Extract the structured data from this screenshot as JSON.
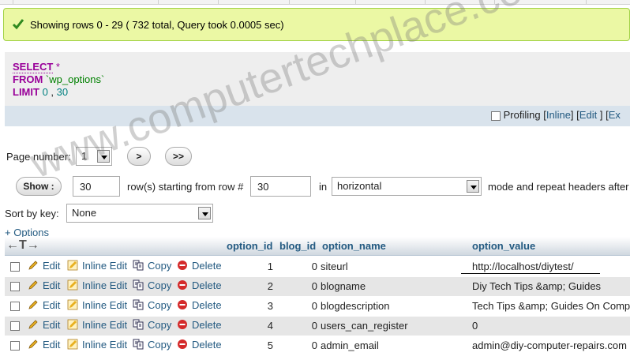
{
  "status": {
    "message": "Showing rows 0 - 29 ( 732 total, Query took 0.0005 sec)"
  },
  "sql": {
    "select_kw": "SELECT",
    "star": "*",
    "from_kw": "FROM",
    "table": "`wp_options`",
    "limit_kw": "LIMIT",
    "limit_start": "0",
    "limit_sep": ",",
    "limit_count": "30"
  },
  "options_bar": {
    "profiling_label": "Profiling",
    "open_bracket_1": "[",
    "inline_label": "Inline",
    "close_bracket_1": "]",
    "open_bracket_2": "[",
    "edit_label": "Edit",
    "close_bracket_3": "]",
    "open_bracket_3": "[",
    "explain_label": "Ex"
  },
  "navigation": {
    "page_number_label": "Page number:",
    "page_number_value": "1",
    "next_label": ">",
    "last_label": ">>",
    "show_label": "Show :",
    "rows_value": "30",
    "rows_label": "row(s) starting from row #",
    "start_row_value": "30",
    "in_label": "in",
    "mode_value": "horizontal",
    "mode_label": "mode and repeat headers after",
    "sort_label": "Sort by key:",
    "sort_value": "None",
    "options_link": "+ Options"
  },
  "table": {
    "columns": [
      "option_id",
      "blog_id",
      "option_name",
      "option_value"
    ],
    "actions": {
      "edit": "Edit",
      "inline_edit": "Inline Edit",
      "copy": "Copy",
      "delete": "Delete"
    },
    "rows": [
      {
        "option_id": "1",
        "blog_id": "0",
        "option_name": "siteurl",
        "option_value": "http://localhost/diytest/"
      },
      {
        "option_id": "2",
        "blog_id": "0",
        "option_name": "blogname",
        "option_value": "Diy Tech Tips &amp; Guides"
      },
      {
        "option_id": "3",
        "blog_id": "0",
        "option_name": "blogdescription",
        "option_value": "Tech Tips &amp; Guides On Comp"
      },
      {
        "option_id": "4",
        "blog_id": "0",
        "option_name": "users_can_register",
        "option_value": "0"
      },
      {
        "option_id": "5",
        "blog_id": "0",
        "option_name": "admin_email",
        "option_value": "admin@diy-computer-repairs.com"
      }
    ]
  },
  "watermark": "www.computertechplace.com",
  "colors": {
    "success_bg": "#ebf8a4",
    "keyword": "#990099",
    "link": "#235a81",
    "row_alt": "#e6e6e6"
  }
}
